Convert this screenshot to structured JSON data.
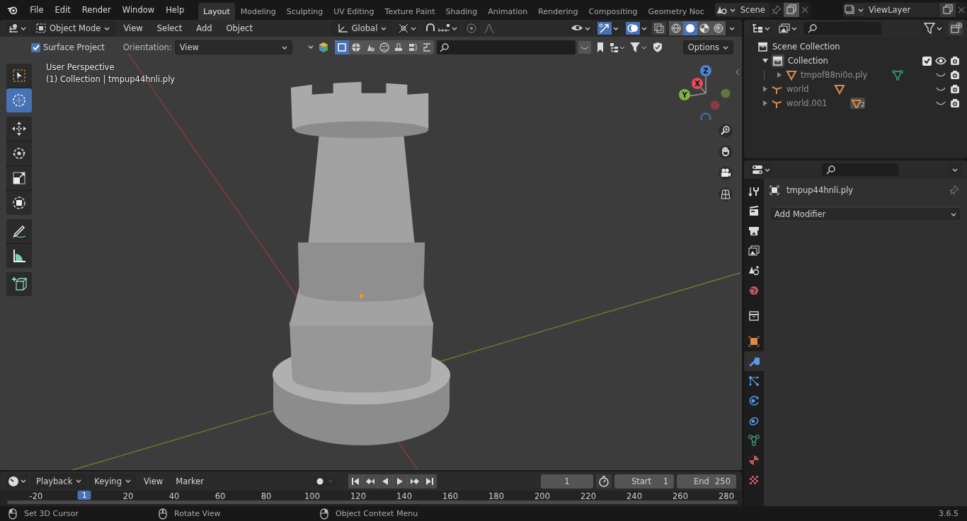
{
  "menu": [
    "File",
    "Edit",
    "Render",
    "Window",
    "Help"
  ],
  "workspaces": [
    {
      "label": "Layout",
      "selected": true
    },
    {
      "label": "Modeling",
      "selected": false
    },
    {
      "label": "Sculpting",
      "selected": false
    },
    {
      "label": "UV Editing",
      "selected": false
    },
    {
      "label": "Texture Paint",
      "selected": false
    },
    {
      "label": "Shading",
      "selected": false
    },
    {
      "label": "Animation",
      "selected": false
    },
    {
      "label": "Rendering",
      "selected": false
    },
    {
      "label": "Compositing",
      "selected": false
    },
    {
      "label": "Geometry Noc",
      "selected": false
    }
  ],
  "scene": "Scene",
  "view_layer": "ViewLayer",
  "viewport_header": {
    "mode": "Object Mode",
    "menus": [
      "View",
      "Select",
      "Add",
      "Object"
    ],
    "orientation": "Global",
    "shading_modes": [
      {
        "kind": "wireframe",
        "selected": false
      },
      {
        "kind": "solid",
        "selected": true
      },
      {
        "kind": "material",
        "selected": false
      },
      {
        "kind": "rendered",
        "selected": false
      }
    ]
  },
  "tool_settings": {
    "surface_project": {
      "label": "Surface Project",
      "checked": true
    },
    "orientation_label": "Orientation:",
    "orientation": "View",
    "options": "Options"
  },
  "viewport_info": [
    "User Perspective",
    "(1) Collection | tmpup44hnli.ply"
  ],
  "tools": [
    {
      "kind": "select",
      "selected": false
    },
    {
      "kind": "cursor",
      "selected": true
    },
    {
      "kind": "move",
      "selected": false
    },
    {
      "kind": "rotate",
      "selected": false
    },
    {
      "kind": "scale",
      "selected": false
    },
    {
      "kind": "transform",
      "selected": false
    },
    {
      "kind": "annotate",
      "selected": false
    },
    {
      "kind": "measure",
      "selected": false
    },
    {
      "kind": "add_cube",
      "selected": false
    }
  ],
  "gizmo_axes": [
    "X",
    "Y",
    "Z"
  ],
  "outliner": {
    "items": [
      {
        "label": "Scene Collection",
        "kind": "collection",
        "children": [
          {
            "label": "Collection",
            "kind": "collection",
            "expanded": true,
            "children": [
              {
                "label": "tmpof88ni0o.ply",
                "kind": "mesh",
                "expanded": false
              }
            ]
          },
          {
            "label": "world",
            "kind": "empty",
            "expanded": false
          },
          {
            "label": "world.001",
            "kind": "empty",
            "expanded": false,
            "badge": "2"
          }
        ]
      }
    ]
  },
  "properties": {
    "object_name": "tmpup44hnli.ply",
    "add_modifier": "Add Modifier",
    "tabs": [
      {
        "kind": "tool",
        "selected": false
      },
      {
        "kind": "render",
        "selected": false
      },
      {
        "kind": "output",
        "selected": false
      },
      {
        "kind": "view_layer",
        "selected": false
      },
      {
        "kind": "scene",
        "selected": false
      },
      {
        "kind": "world",
        "selected": false
      },
      {
        "kind": "collection",
        "selected": false
      },
      {
        "kind": "object",
        "selected": false
      },
      {
        "kind": "modifier",
        "selected": true
      },
      {
        "kind": "particles",
        "selected": false
      },
      {
        "kind": "physics",
        "selected": false
      },
      {
        "kind": "constraints",
        "selected": false
      },
      {
        "kind": "data",
        "selected": false
      },
      {
        "kind": "material",
        "selected": false
      },
      {
        "kind": "texture",
        "selected": false
      }
    ]
  },
  "timeline": {
    "menus": [
      "Playback",
      "Keying",
      "View",
      "Marker"
    ],
    "frame": "1",
    "start_label": "Start",
    "start": "1",
    "end_label": "End",
    "end": "250",
    "current": "1",
    "ruler": [
      "-20",
      "20",
      "40",
      "60",
      "80",
      "100",
      "120",
      "140",
      "160",
      "180",
      "200",
      "220",
      "240",
      "260",
      "280"
    ]
  },
  "status_bar": {
    "hints": [
      "Set 3D Cursor",
      "Rotate View",
      "Object Context Menu"
    ],
    "version": "3.6.5"
  }
}
